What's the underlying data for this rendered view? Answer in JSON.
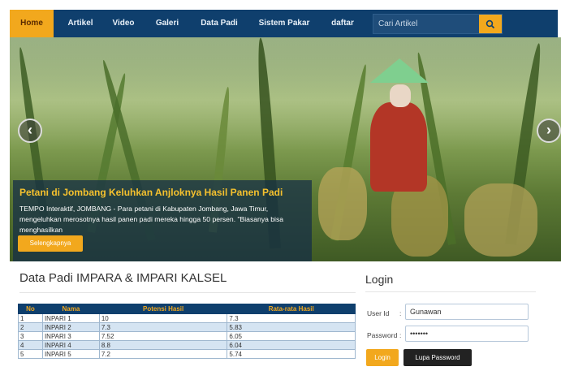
{
  "nav": {
    "items": [
      {
        "label": "Home",
        "active": true
      },
      {
        "label": "Artikel"
      },
      {
        "label": "Video"
      },
      {
        "label": "Galeri"
      },
      {
        "label": "Data Padi"
      },
      {
        "label": "Sistem Pakar"
      },
      {
        "label": "daftar"
      }
    ],
    "search_placeholder": "Cari Artikel",
    "search_icon": "search-icon"
  },
  "hero": {
    "prev_icon": "chevron-left-icon",
    "next_icon": "chevron-right-icon",
    "prev_glyph": "‹",
    "next_glyph": "›",
    "caption_title": "Petani di Jombang Keluhkan Anjloknya Hasil Panen Padi",
    "caption_text": "TEMPO Interaktif, JOMBANG - Para petani di Kabupaten Jombang, Jawa Timur, mengeluhkan merosotnya hasil panen padi mereka hingga 50 persen. \"Biasanya bisa menghasilkan",
    "more_label": "Selengkapnya"
  },
  "table_section": {
    "title": "Data Padi IMPARA & IMPARI KALSEL",
    "headers": [
      "No",
      "Nama",
      "Potensi Hasil",
      "Rata-rata Hasil"
    ],
    "rows": [
      [
        "1",
        "INPARI 1",
        "10",
        "7.3"
      ],
      [
        "2",
        "INPARI 2",
        "7.3",
        "5.83"
      ],
      [
        "3",
        "INPARI 3",
        "7.52",
        "6.05"
      ],
      [
        "4",
        "INPARI 4",
        "8.8",
        "6.04"
      ],
      [
        "5",
        "INPARI 5",
        "7.2",
        "5.74"
      ]
    ]
  },
  "login": {
    "title": "Login",
    "userid_label": "User Id",
    "password_label": "Password",
    "colon": ":",
    "userid_value": "Gunawan",
    "password_value": "•••••••",
    "login_button": "Login",
    "lupa_button": "Lupa Password"
  },
  "colors": {
    "nav_bg": "#0f3f6d",
    "accent": "#f2a81d"
  }
}
